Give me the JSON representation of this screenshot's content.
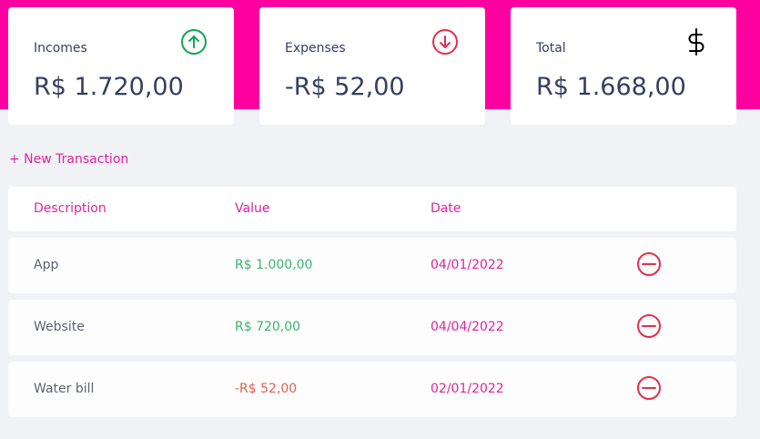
{
  "summary": {
    "incomes": {
      "label": "Incomes",
      "amount": "R$ 1.720,00",
      "icon": "arrow-up-circle-icon",
      "color": "#12a454"
    },
    "expenses": {
      "label": "Expenses",
      "amount": "-R$ 52,00",
      "icon": "arrow-down-circle-icon",
      "color": "#e52e4d"
    },
    "total": {
      "label": "Total",
      "amount": "R$ 1.668,00",
      "icon": "dollar-sign-icon",
      "color": "#000000"
    }
  },
  "actions": {
    "new_transaction": "+ New Transaction"
  },
  "table": {
    "headers": {
      "description": "Description",
      "value": "Value",
      "date": "Date"
    },
    "rows": [
      {
        "description": "App",
        "value": "R$ 1.000,00",
        "date": "04/01/2022",
        "type": "income"
      },
      {
        "description": "Website",
        "value": "R$ 720,00",
        "date": "04/04/2022",
        "type": "income"
      },
      {
        "description": "Water bill",
        "value": "-R$ 52,00",
        "date": "02/01/2022",
        "type": "expense"
      }
    ],
    "remove_icon": "minus-circle-icon"
  },
  "colors": {
    "brand": "#ff00a0",
    "accent_text": "#e0249b",
    "income": "#3bb56c",
    "expense": "#e55f4c"
  }
}
